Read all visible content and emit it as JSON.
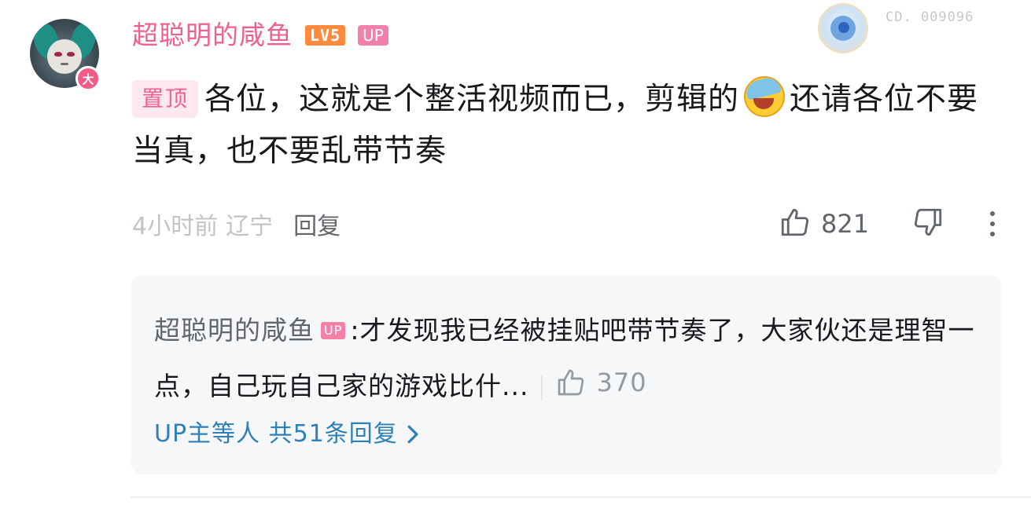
{
  "comment": {
    "username": "超聪明的咸鱼",
    "level": "LV5",
    "up_badge": "UP",
    "avatar_badge": "大",
    "fan_medal_id": "CD. 009096",
    "pin_tag": "置顶",
    "text_part1": "各位，这就是个整活视频而已，剪辑的",
    "emote": "laughing-crying-emoji",
    "text_part2": "还请各位不要当真，也不要乱带节奏",
    "time": "4小时前",
    "location": "辽宁",
    "reply_label": "回复",
    "like_count": "821"
  },
  "reply": {
    "username": "超聪明的咸鱼",
    "up_badge": "UP",
    "separator": ":",
    "text": "才发现我已经被挂贴吧带节奏了，大家伙还是理智一点，自己玩自己家的游戏比什...",
    "like_count": "370",
    "view_more": "UP主等人 共51条回复"
  },
  "colors": {
    "username_pink": "#f0608f",
    "level_orange": "#ff8a3d",
    "link_blue": "#2f7fb8",
    "reply_bg": "#f6f7f8"
  },
  "icons": [
    "thumb-up-icon",
    "thumb-down-icon",
    "more-vertical-icon",
    "chevron-right-icon"
  ]
}
